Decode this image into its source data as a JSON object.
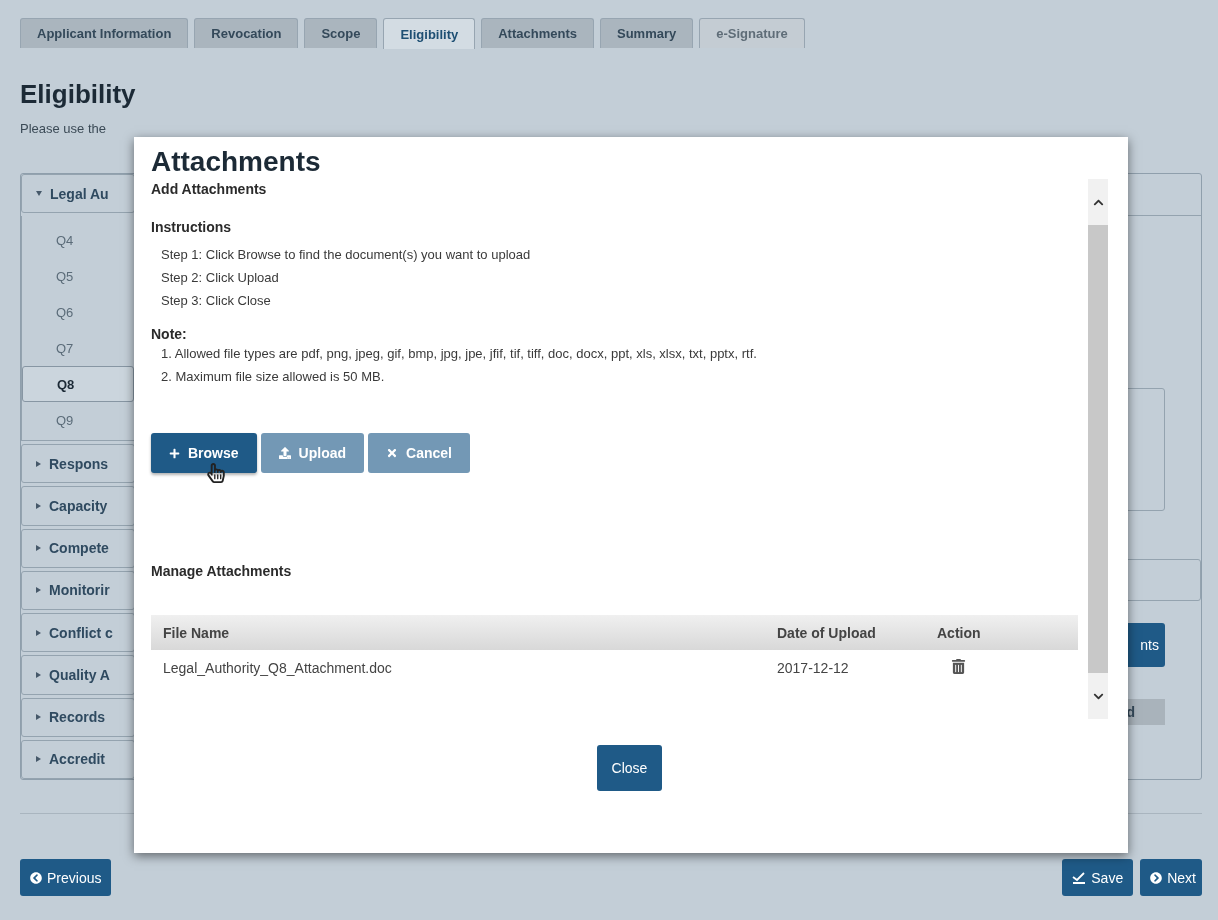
{
  "tabs": [
    {
      "label": "Applicant Information",
      "selected": false,
      "disabled": false
    },
    {
      "label": "Revocation",
      "selected": false,
      "disabled": false
    },
    {
      "label": "Scope",
      "selected": false,
      "disabled": false
    },
    {
      "label": "Eligibility",
      "selected": true,
      "disabled": false
    },
    {
      "label": "Attachments",
      "selected": false,
      "disabled": false
    },
    {
      "label": "Summary",
      "selected": false,
      "disabled": false
    },
    {
      "label": "e-Signature",
      "selected": false,
      "disabled": true
    }
  ],
  "page": {
    "title": "Eligibility",
    "instruction": "Please use the"
  },
  "sidebar": {
    "sections": [
      {
        "label": "Legal Au",
        "expanded": true,
        "items": [
          {
            "label": "Q4",
            "selected": false
          },
          {
            "label": "Q5",
            "selected": false
          },
          {
            "label": "Q6",
            "selected": false
          },
          {
            "label": "Q7",
            "selected": false
          },
          {
            "label": "Q8",
            "selected": true
          },
          {
            "label": "Q9",
            "selected": false
          }
        ]
      },
      {
        "label": "Respons",
        "expanded": false
      },
      {
        "label": "Capacity",
        "expanded": false
      },
      {
        "label": "Compete",
        "expanded": false
      },
      {
        "label": "Monitorir",
        "expanded": false
      },
      {
        "label": "Conflict c",
        "expanded": false
      },
      {
        "label": "Quality A",
        "expanded": false
      },
      {
        "label": "Records",
        "expanded": false
      },
      {
        "label": "Accredit",
        "expanded": false
      }
    ]
  },
  "right_fragments": {
    "primary_button": "nts",
    "secondary_button": "d"
  },
  "dialog": {
    "title": "Attachments",
    "subtitle": "Add Attachments",
    "instructions_heading": "Instructions",
    "steps": [
      "Step 1: Click Browse to find the document(s) you want to upload",
      "Step 2: Click Upload",
      "Step 3: Click Close"
    ],
    "note_heading": "Note:",
    "notes": [
      "1. Allowed file types are pdf, png, jpeg, gif, bmp, jpg, jpe, jfif, tif, tiff, doc, docx, ppt, xls, xlsx, txt, pptx, rtf.",
      "2. Maximum file size allowed is 50 MB."
    ],
    "buttons": [
      {
        "label": "Browse",
        "kind": "browse",
        "disabled": false
      },
      {
        "label": "Upload",
        "kind": "upload",
        "disabled": true
      },
      {
        "label": "Cancel",
        "kind": "cancel",
        "disabled": true
      }
    ],
    "manage_heading": "Manage Attachments",
    "table": {
      "columns": [
        "File Name",
        "Date of Upload",
        "Action"
      ],
      "rows": [
        {
          "file_name": "Legal_Authority_Q8_Attachment.doc",
          "date": "2017-12-12"
        }
      ]
    },
    "close_label": "Close"
  },
  "footer": {
    "previous": "Previous",
    "save": "Save",
    "next": "Next"
  }
}
